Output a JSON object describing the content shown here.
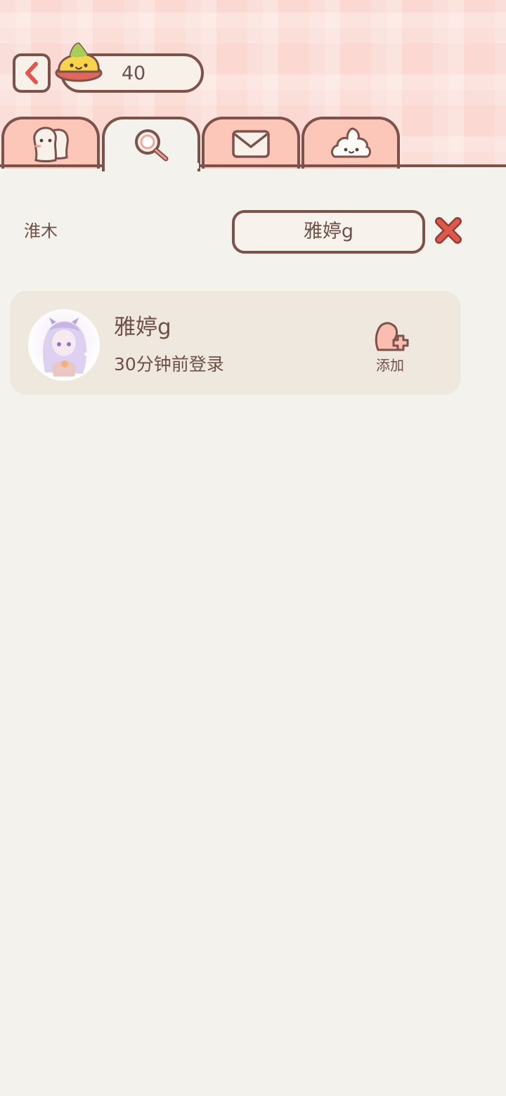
{
  "header": {
    "back_icon": "chevron-left-icon",
    "coin_icon": "green-mascot-coin-icon",
    "coin_count": "40"
  },
  "tabs": [
    {
      "icon": "friends-icon",
      "active": false
    },
    {
      "icon": "search-icon",
      "active": true
    },
    {
      "icon": "mail-icon",
      "active": false
    },
    {
      "icon": "mascot-icon",
      "active": false
    }
  ],
  "search": {
    "current_user": "淮木",
    "query": "雅婷g",
    "clear_icon": "close-x-icon"
  },
  "results": [
    {
      "name": "雅婷g",
      "status": "30分钟前登录",
      "avatar_icon": "avatar-image",
      "action_label": "添加",
      "action_icon": "add-friend-icon"
    }
  ],
  "colors": {
    "outline": "#7c524a",
    "text": "#6d5048",
    "tab_pink": "#fcc7b8",
    "page_bg": "#f4f2ec",
    "card_bg": "#efe8de",
    "accent_red": "#e2574c"
  }
}
